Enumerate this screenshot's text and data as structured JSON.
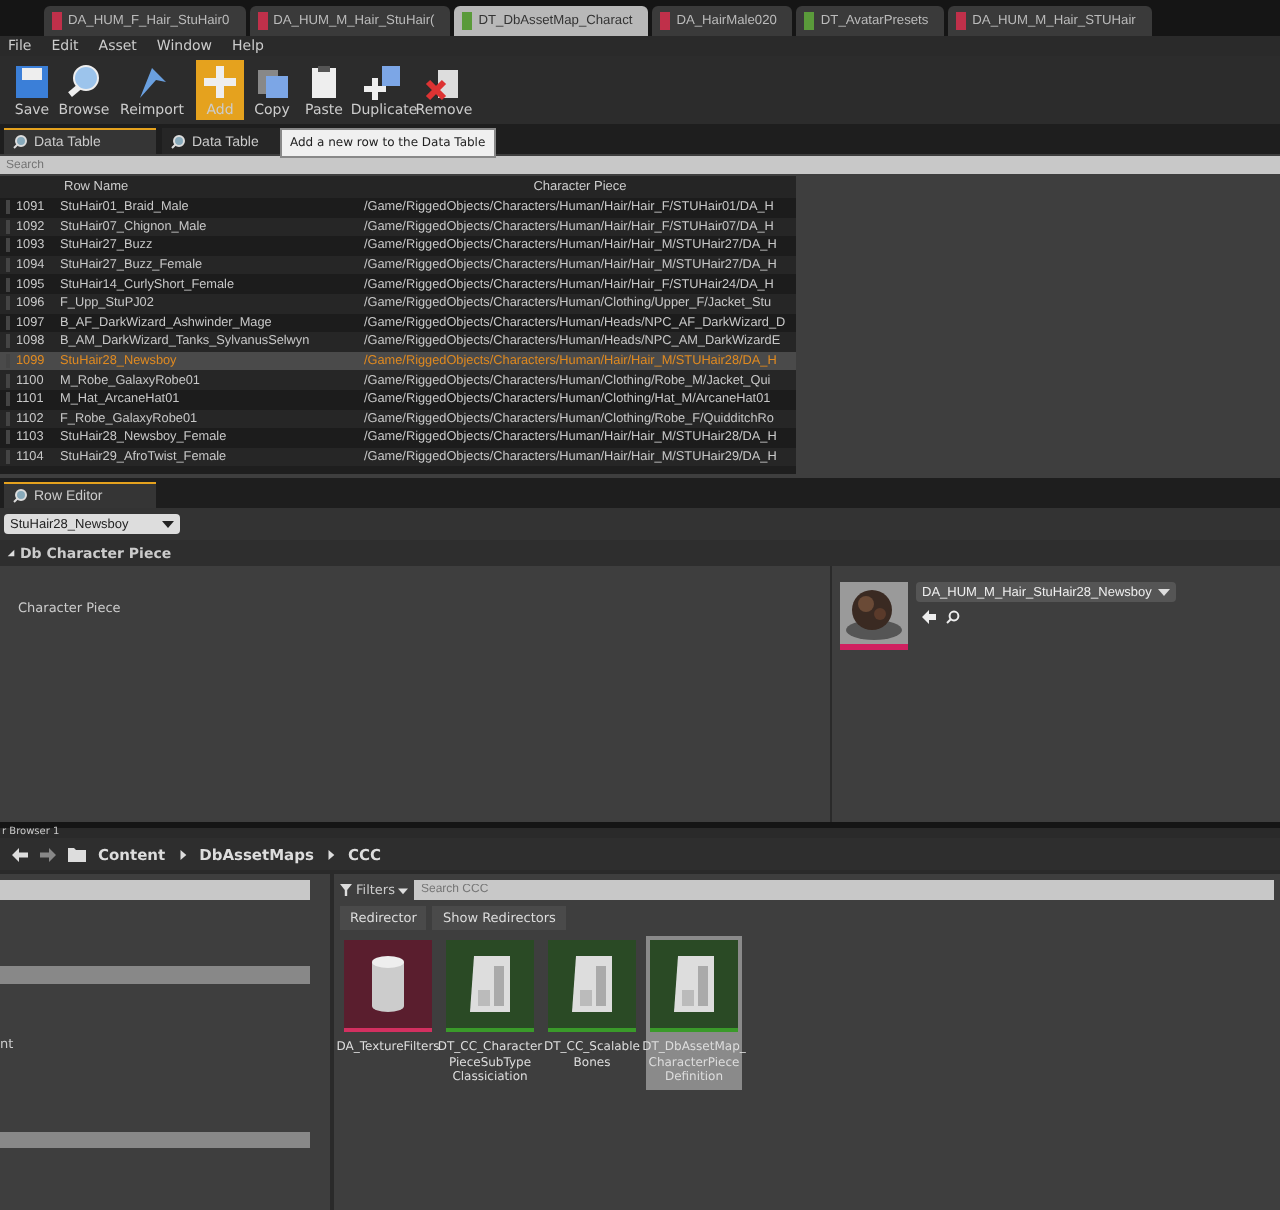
{
  "doc_tabs": [
    {
      "label": "DA_HUM_F_Hair_StuHair0",
      "color": "#c0304a",
      "selected": false
    },
    {
      "label": "DA_HUM_M_Hair_StuHair(",
      "color": "#c0304a",
      "selected": false
    },
    {
      "label": "DT_DbAssetMap_Charact",
      "color": "#5a9a3a",
      "selected": true
    },
    {
      "label": "DA_HairMale020",
      "color": "#c0304a",
      "selected": false
    },
    {
      "label": "DT_AvatarPresets",
      "color": "#5a9a3a",
      "selected": false
    },
    {
      "label": "DA_HUM_M_Hair_STUHair",
      "color": "#c0304a",
      "selected": false
    }
  ],
  "menu": [
    "File",
    "Edit",
    "Asset",
    "Window",
    "Help"
  ],
  "toolbar": [
    {
      "label": "Save",
      "kind": "save",
      "selected": false
    },
    {
      "label": "Browse",
      "kind": "browse",
      "selected": false
    },
    {
      "label": "Reimport",
      "kind": "reimport",
      "selected": false
    },
    {
      "label": "Add",
      "kind": "add",
      "selected": true
    },
    {
      "label": "Copy",
      "kind": "copy",
      "selected": false
    },
    {
      "label": "Paste",
      "kind": "paste",
      "selected": false
    },
    {
      "label": "Duplicate",
      "kind": "duplicate",
      "selected": false
    },
    {
      "label": "Remove",
      "kind": "remove",
      "selected": false
    }
  ],
  "tooltip": "Add a new row to the Data Table",
  "panel_tabs": [
    {
      "label": "Data Table",
      "selected": true
    },
    {
      "label": "Data Table",
      "selected": false
    }
  ],
  "search": {
    "placeholder": "Search"
  },
  "table": {
    "columns": [
      "Row Name",
      "Character Piece"
    ],
    "rows": [
      {
        "index": "1091",
        "name": "StuHair01_Braid_Male",
        "path": "/Game/RiggedObjects/Characters/Human/Hair/Hair_F/STUHair01/DA_H",
        "selected": false
      },
      {
        "index": "1092",
        "name": "StuHair07_Chignon_Male",
        "path": "/Game/RiggedObjects/Characters/Human/Hair/Hair_F/STUHair07/DA_H",
        "selected": false
      },
      {
        "index": "1093",
        "name": "StuHair27_Buzz",
        "path": "/Game/RiggedObjects/Characters/Human/Hair/Hair_M/STUHair27/DA_H",
        "selected": false
      },
      {
        "index": "1094",
        "name": "StuHair27_Buzz_Female",
        "path": "/Game/RiggedObjects/Characters/Human/Hair/Hair_M/STUHair27/DA_H",
        "selected": false
      },
      {
        "index": "1095",
        "name": "StuHair14_CurlyShort_Female",
        "path": "/Game/RiggedObjects/Characters/Human/Hair/Hair_F/STUHair24/DA_H",
        "selected": false
      },
      {
        "index": "1096",
        "name": "F_Upp_StuPJ02",
        "path": "/Game/RiggedObjects/Characters/Human/Clothing/Upper_F/Jacket_Stu",
        "selected": false
      },
      {
        "index": "1097",
        "name": "B_AF_DarkWizard_Ashwinder_Mage",
        "path": "/Game/RiggedObjects/Characters/Human/Heads/NPC_AF_DarkWizard_D",
        "selected": false
      },
      {
        "index": "1098",
        "name": "B_AM_DarkWizard_Tanks_SylvanusSelwyn",
        "path": "/Game/RiggedObjects/Characters/Human/Heads/NPC_AM_DarkWizardE",
        "selected": false
      },
      {
        "index": "1099",
        "name": "StuHair28_Newsboy",
        "path": "/Game/RiggedObjects/Characters/Human/Hair/Hair_M/STUHair28/DA_H",
        "selected": true
      },
      {
        "index": "1100",
        "name": "M_Robe_GalaxyRobe01",
        "path": "/Game/RiggedObjects/Characters/Human/Clothing/Robe_M/Jacket_Qui",
        "selected": false
      },
      {
        "index": "1101",
        "name": "M_Hat_ArcaneHat01",
        "path": "/Game/RiggedObjects/Characters/Human/Clothing/Hat_M/ArcaneHat01",
        "selected": false
      },
      {
        "index": "1102",
        "name": "F_Robe_GalaxyRobe01",
        "path": "/Game/RiggedObjects/Characters/Human/Clothing/Robe_F/QuidditchRo",
        "selected": false
      },
      {
        "index": "1103",
        "name": "StuHair28_Newsboy_Female",
        "path": "/Game/RiggedObjects/Characters/Human/Hair/Hair_M/STUHair28/DA_H",
        "selected": false
      },
      {
        "index": "1104",
        "name": "StuHair29_AfroTwist_Female",
        "path": "/Game/RiggedObjects/Characters/Human/Hair/Hair_M/STUHair29/DA_H",
        "selected": false
      }
    ]
  },
  "row_editor": {
    "tab": "Row Editor",
    "row_select": "StuHair28_Newsboy",
    "section": "Db Character Piece",
    "property": "Character Piece",
    "asset_select": "DA_HUM_M_Hair_StuHair28_Newsboy"
  },
  "content_browser": {
    "tab": "r Browser 1",
    "breadcrumb": [
      "Content",
      "DbAssetMaps",
      "CCC"
    ],
    "left_item": "nt",
    "filters": "Filters",
    "search": {
      "placeholder": "Search CCC"
    },
    "chips": [
      "Redirector",
      "Show Redirectors"
    ],
    "assets": [
      {
        "lines": [
          "DA_TextureFilters"
        ],
        "kind": "data-asset",
        "selected": false
      },
      {
        "lines": [
          "DT_CC_Character",
          "PieceSubType",
          "Classiciation"
        ],
        "kind": "data-table",
        "selected": false
      },
      {
        "lines": [
          "DT_CC_Scalable",
          "Bones"
        ],
        "kind": "data-table",
        "selected": false
      },
      {
        "lines": [
          "DT_DbAssetMap_",
          "CharacterPiece",
          "Definition"
        ],
        "kind": "data-table",
        "selected": true
      }
    ]
  }
}
